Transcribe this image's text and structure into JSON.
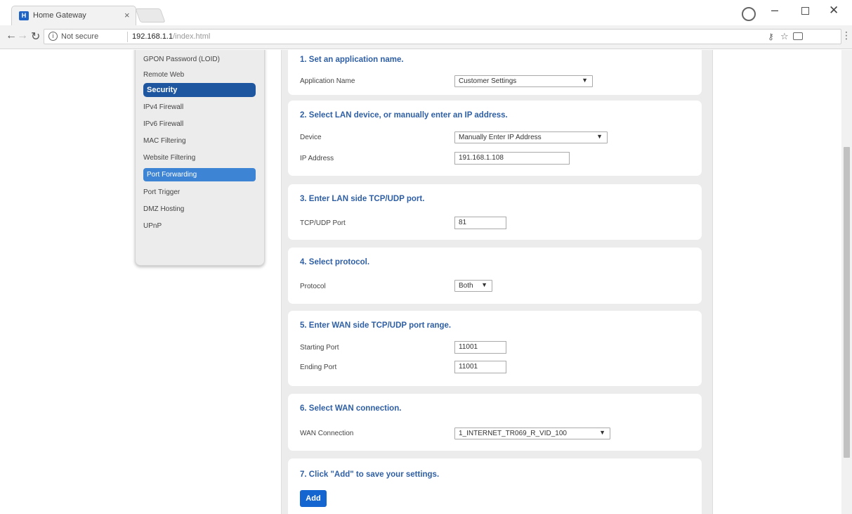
{
  "browser": {
    "tab_title": "Home Gateway",
    "tab_close": "×",
    "favicon": "H",
    "security_label": "Not secure",
    "url_host": "192.168.1.1",
    "url_path": "/index.html",
    "icons": [
      "back-icon",
      "forward-icon",
      "reload-icon",
      "info-icon",
      "key-icon",
      "star-icon",
      "cast-icon",
      "menu-icon",
      "profile-icon",
      "minimize-icon",
      "restore-icon",
      "close-window-icon"
    ]
  },
  "sidebar": {
    "items_top": [
      "GPON Password (LOID)",
      "Remote Web"
    ],
    "section_heading": "Security",
    "items_security": [
      "IPv4 Firewall",
      "IPv6 Firewall",
      "MAC Filtering",
      "Website Filtering",
      "Port Forwarding",
      "Port Trigger",
      "DMZ Hosting",
      "UPnP"
    ],
    "active_item": "Port Forwarding"
  },
  "form": {
    "step1": {
      "title": "1. Set an application name.",
      "label": "Application Name",
      "value": "Customer Settings"
    },
    "step2": {
      "title": "2. Select LAN device, or manually enter an IP address.",
      "device_label": "Device",
      "device_value": "Manually Enter IP Address",
      "ip_label": "IP Address",
      "ip_value": "191.168.1.108"
    },
    "step3": {
      "title": "3. Enter LAN side TCP/UDP port.",
      "label": "TCP/UDP Port",
      "value": "81"
    },
    "step4": {
      "title": "4. Select protocol.",
      "label": "Protocol",
      "value": "Both"
    },
    "step5": {
      "title": "5. Enter WAN side TCP/UDP port range.",
      "start_label": "Starting Port",
      "start_value": "11001",
      "end_label": "Ending Port",
      "end_value": "11001"
    },
    "step6": {
      "title": "6. Select WAN connection.",
      "label": "WAN Connection",
      "value": "1_INTERNET_TR069_R_VID_100"
    },
    "step7": {
      "title": "7. Click \"Add\" to save your settings.",
      "button": "Add"
    }
  },
  "colors": {
    "accent": "#1e56a0",
    "active": "#3d84d4",
    "title": "#2e5fa5",
    "button": "#1565d0"
  }
}
